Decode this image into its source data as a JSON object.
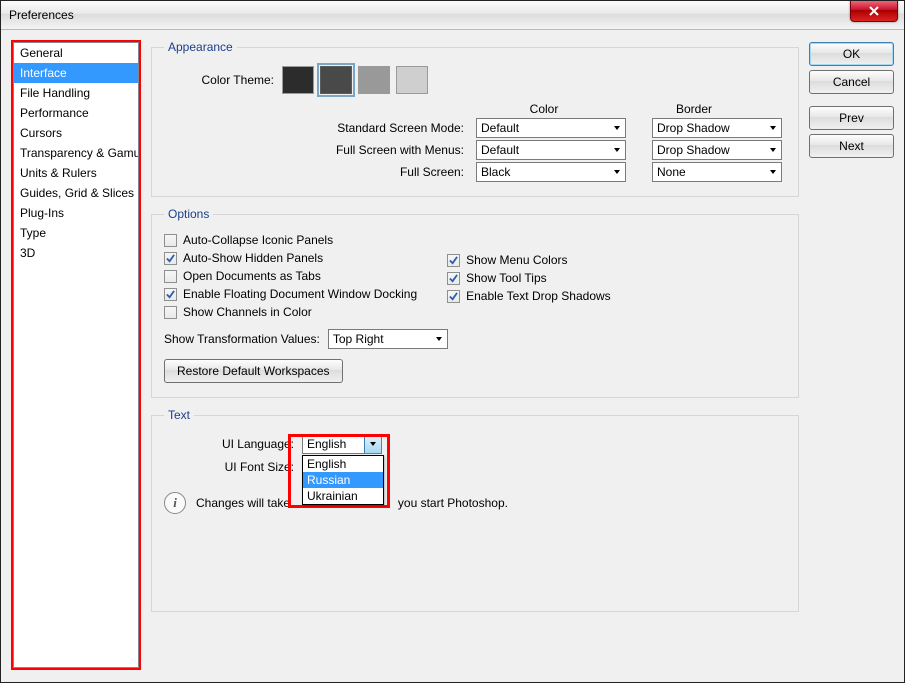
{
  "window": {
    "title": "Preferences"
  },
  "categories": {
    "items": [
      {
        "label": "General"
      },
      {
        "label": "Interface"
      },
      {
        "label": "File Handling"
      },
      {
        "label": "Performance"
      },
      {
        "label": "Cursors"
      },
      {
        "label": "Transparency & Gamut"
      },
      {
        "label": "Units & Rulers"
      },
      {
        "label": "Guides, Grid & Slices"
      },
      {
        "label": "Plug-Ins"
      },
      {
        "label": "Type"
      },
      {
        "label": "3D"
      }
    ],
    "selected_index": 1
  },
  "buttons": {
    "ok": "OK",
    "cancel": "Cancel",
    "prev": "Prev",
    "next": "Next"
  },
  "appearance": {
    "legend": "Appearance",
    "color_theme_label": "Color Theme:",
    "swatches": [
      "#2c2c2c",
      "#494949",
      "#999999",
      "#cfcfcf"
    ],
    "swatch_selected_index": 1,
    "header_color": "Color",
    "header_border": "Border",
    "rows": [
      {
        "label": "Standard Screen Mode:",
        "color": "Default",
        "border": "Drop Shadow"
      },
      {
        "label": "Full Screen with Menus:",
        "color": "Default",
        "border": "Drop Shadow"
      },
      {
        "label": "Full Screen:",
        "color": "Black",
        "border": "None"
      }
    ]
  },
  "options": {
    "legend": "Options",
    "left": [
      {
        "label": "Auto-Collapse Iconic Panels",
        "checked": false
      },
      {
        "label": "Auto-Show Hidden Panels",
        "checked": true
      },
      {
        "label": "Open Documents as Tabs",
        "checked": false
      },
      {
        "label": "Enable Floating Document Window Docking",
        "checked": true
      },
      {
        "label": "Show Channels in Color",
        "checked": false
      }
    ],
    "right": [
      {
        "label": "Show Menu Colors",
        "checked": true
      },
      {
        "label": "Show Tool Tips",
        "checked": true
      },
      {
        "label": "Enable Text Drop Shadows",
        "checked": true
      }
    ],
    "transform_label": "Show Transformation Values:",
    "transform_value": "Top Right",
    "restore_btn": "Restore Default Workspaces"
  },
  "text": {
    "legend": "Text",
    "ui_language_label": "UI Language:",
    "ui_language_value": "English",
    "ui_language_options": [
      "English",
      "Russian",
      "Ukrainian"
    ],
    "ui_language_highlight_index": 1,
    "ui_font_size_label": "UI Font Size:",
    "note_before": "Changes will take ",
    "note_after": " you start Photoshop."
  }
}
